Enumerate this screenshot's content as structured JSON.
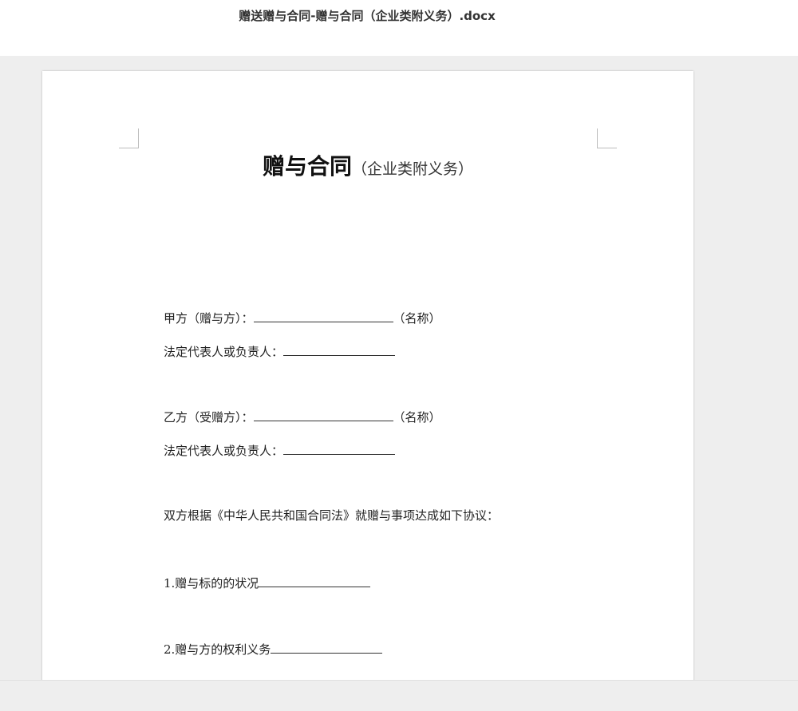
{
  "window": {
    "title": "赠送赠与合同-赠与合同（企业类附义务）.docx"
  },
  "document": {
    "heading_main": "赠与合同",
    "heading_sub": "（企业类附义务）",
    "party_a": {
      "label": "甲方（赠与方）：",
      "suffix": "（名称）"
    },
    "party_a_rep": {
      "label": "法定代表人或负责人："
    },
    "party_b": {
      "label": "乙方（受赠方）：",
      "suffix": "（名称）"
    },
    "party_b_rep": {
      "label": "法定代表人或负责人："
    },
    "agreement_text": "双方根据《中华人民共和国合同法》就赠与事项达成如下协议：",
    "clauses": [
      {
        "label": "1.赠与标的的状况"
      },
      {
        "label": "2.赠与方的权利义务"
      }
    ]
  }
}
